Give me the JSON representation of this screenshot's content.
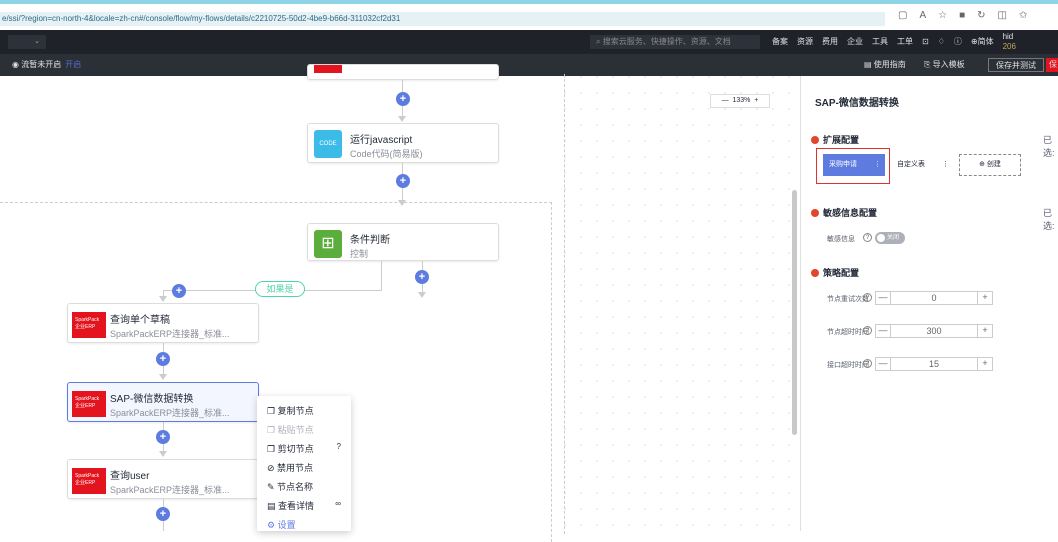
{
  "browser": {
    "url": "e/ssi/?region=cn-north-4&locale=zh-cn#/console/flow/my-flows/details/c2210725-50d2-4be9-b66d-311032cf2d31",
    "icons": [
      "tab-icon",
      "read-icon",
      "star-icon",
      "ext-icon",
      "refresh-icon",
      "split-icon",
      "favorites-icon"
    ]
  },
  "topnav": {
    "search_placeholder": "搜索云服务、快捷操作、资源、文档",
    "menu": [
      "备案",
      "资源",
      "费用",
      "企业",
      "工具",
      "工单"
    ],
    "lang": "简体",
    "user": "hid",
    "user_sub": "206"
  },
  "subbar": {
    "status": "流暂未开启",
    "status_link": "开启",
    "guide": "使用指南",
    "import": "导入模板",
    "save_test": "保存并测试",
    "save": "保"
  },
  "canvas": {
    "zoom": "133%",
    "nodes": [
      {
        "title": "运行javascript",
        "sub": "Code代码(简易版)"
      },
      {
        "title": "条件判断",
        "sub": "控制"
      },
      {
        "title": "查询单个草稿",
        "sub": "SparkPackERP连接器_标准..."
      },
      {
        "title": "SAP-微信数据转换",
        "sub": "SparkPackERP连接器_标准..."
      },
      {
        "title": "查询user",
        "sub": "SparkPackERP连接器_标准..."
      }
    ],
    "branch_label": "如果是",
    "spark_logo": [
      "SparkPack",
      "企业ERP"
    ],
    "code_logo": "CODE"
  },
  "context_menu": [
    {
      "label": "复制节点",
      "disabled": false
    },
    {
      "label": "粘贴节点",
      "disabled": true
    },
    {
      "label": "剪切节点",
      "disabled": false
    },
    {
      "label": "禁用节点",
      "disabled": false
    },
    {
      "label": "节点名称",
      "disabled": false
    },
    {
      "label": "查看详情",
      "disabled": false
    },
    {
      "label": "设置",
      "disabled": false
    }
  ],
  "panel": {
    "title": "SAP-微信数据转换",
    "ext_title": "扩展配置",
    "ext_selected": "已选:",
    "ext_items": [
      "采购申请",
      "自定义表"
    ],
    "create": "创建",
    "sens_title": "敏感信息配置",
    "sens_selected": "已选:",
    "sens_label": "敏感信息",
    "sens_toggle": "关闭",
    "policy_title": "策略配置",
    "policies": [
      {
        "label": "节点重试次数",
        "value": "0"
      },
      {
        "label": "节点超时时间",
        "value": "300"
      },
      {
        "label": "接口超时时间",
        "value": "15"
      }
    ]
  },
  "colors": {
    "accent": "#5e7ce0",
    "brand_red": "#e3141d",
    "condition": "#5bae3c",
    "code": "#3cbbe8",
    "branch": "#50d4ab",
    "select_outline": "#e2312c"
  }
}
